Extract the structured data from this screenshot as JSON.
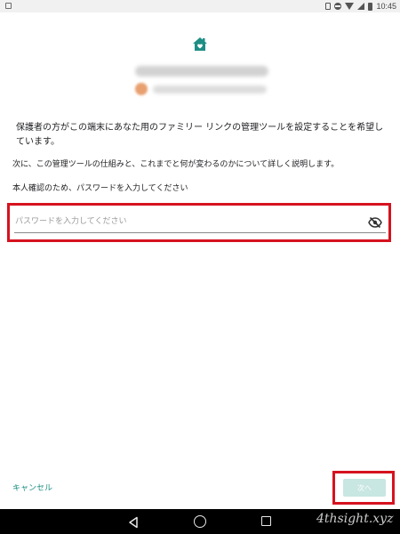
{
  "status_bar": {
    "time": "10:45",
    "icons": [
      "vibrate-icon",
      "do-not-disturb-icon",
      "wifi-icon",
      "signal-icon",
      "battery-icon"
    ]
  },
  "header": {
    "icon": "home-heart-icon",
    "accent_color": "#1e8e85"
  },
  "content": {
    "intro": "保護者の方がこの端末にあなた用のファミリー リンクの管理ツールを設定することを希望しています。",
    "explanation": "次に、この管理ツールの仕組みと、これまでと何が変わるのかについて詳しく説明します。",
    "verify_prompt": "本人確認のため、パスワードを入力してください"
  },
  "password_field": {
    "placeholder": "パスワードを入力してください",
    "value": "",
    "toggle_icon": "visibility-off-icon"
  },
  "actions": {
    "cancel_label": "キャンセル",
    "next_label": "次へ"
  },
  "highlight_color": "#d6121f",
  "nav_bar": {
    "back_icon": "back-triangle-icon",
    "home_icon": "home-circle-icon",
    "recents_icon": "recents-square-icon"
  },
  "watermark": "4thsight.xyz"
}
